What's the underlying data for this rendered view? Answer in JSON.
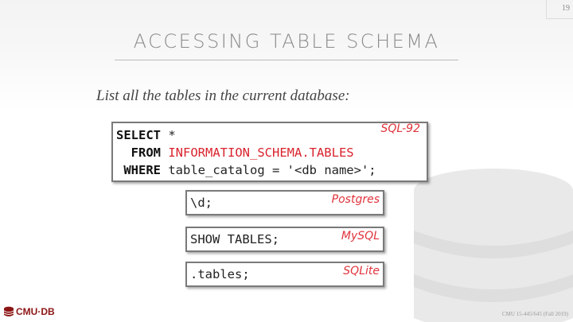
{
  "slide": {
    "number": "19",
    "title": "ACCESSING TABLE SCHEMA",
    "subtitle": "List all the tables in the current database:"
  },
  "sql92": {
    "tag": "SQL-92",
    "kw_select": "SELECT",
    "val_select": " *",
    "kw_from": "FROM",
    "val_from": "INFORMATION_SCHEMA.TABLES",
    "kw_where": "WHERE",
    "val_where": " table_catalog = '<db name>';"
  },
  "postgres": {
    "tag": "Postgres",
    "code": "\\d;"
  },
  "mysql": {
    "tag": "MySQL",
    "code": "SHOW TABLES;"
  },
  "sqlite": {
    "tag": "SQLite",
    "code": ".tables;"
  },
  "footer": {
    "logo_text": "CMU·DB",
    "course": "CMU 15-445/645 (Fall 2019)"
  },
  "colors": {
    "accent_red": "#d9232d",
    "logo_red": "#8c1515",
    "title_gray": "#8a8a8a"
  }
}
